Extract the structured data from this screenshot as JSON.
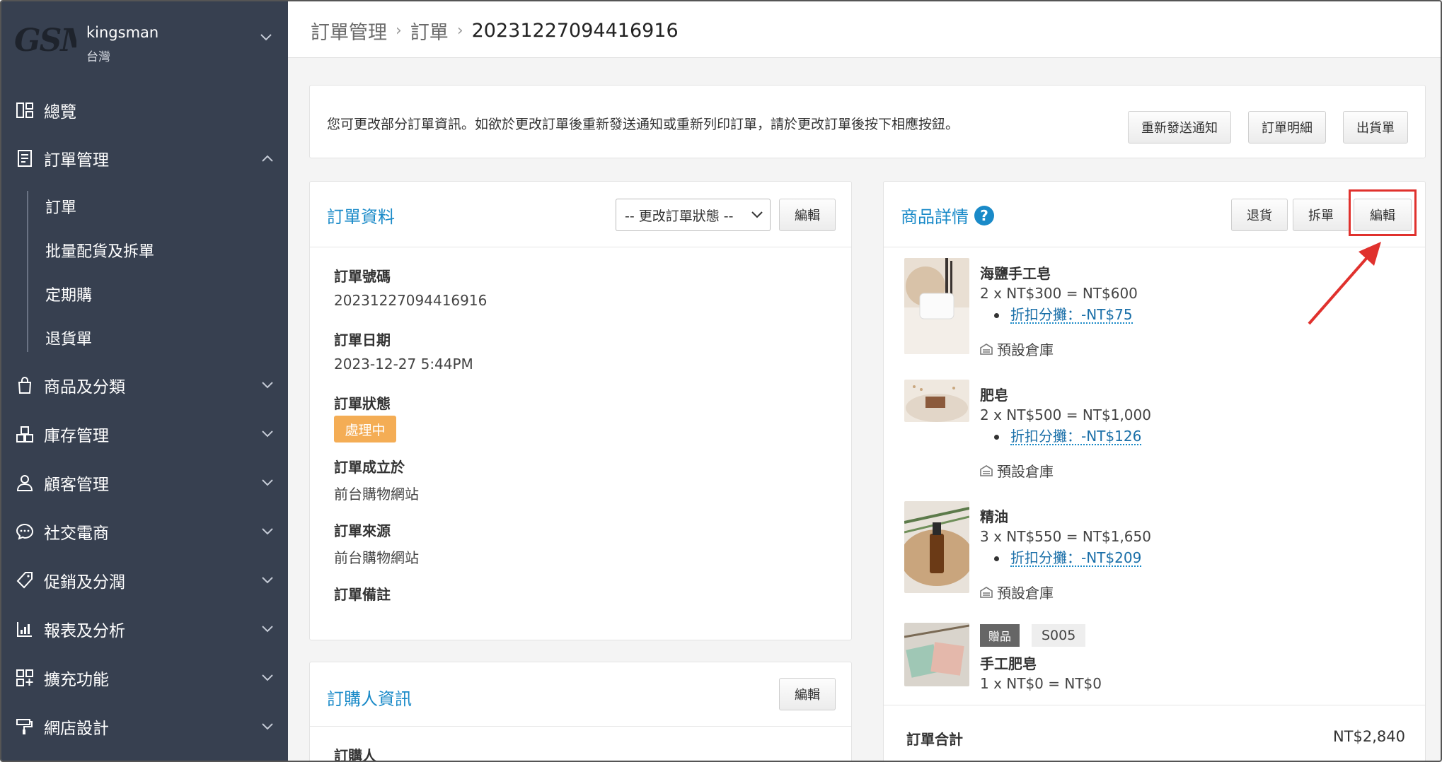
{
  "sidebar": {
    "brand": {
      "logo": "GSM",
      "name": "kingsman",
      "region": "台灣"
    },
    "items": [
      {
        "label": "總覽",
        "icon": "dashboard-icon"
      },
      {
        "label": "訂單管理",
        "icon": "order-icon",
        "expanded": true
      },
      {
        "label": "商品及分類",
        "icon": "shopping-bag-icon"
      },
      {
        "label": "庫存管理",
        "icon": "inventory-icon"
      },
      {
        "label": "顧客管理",
        "icon": "customer-icon"
      },
      {
        "label": "社交電商",
        "icon": "chat-icon"
      },
      {
        "label": "促銷及分潤",
        "icon": "tag-icon"
      },
      {
        "label": "報表及分析",
        "icon": "chart-icon"
      },
      {
        "label": "擴充功能",
        "icon": "apps-icon"
      },
      {
        "label": "網店設計",
        "icon": "paint-roller-icon"
      }
    ],
    "sub_items": [
      "訂單",
      "批量配貨及拆單",
      "定期購",
      "退貨單"
    ]
  },
  "breadcrumb": {
    "level1": "訂單管理",
    "level2": "訂單",
    "current": "20231227094416916"
  },
  "notice": {
    "text": "您可更改部分訂單資訊。如欲於更改訂單後重新發送通知或重新列印訂單，請於更改訂單後按下相應按鈕。",
    "buttons": [
      "重新發送通知",
      "訂單明細",
      "出貨單"
    ]
  },
  "order_info": {
    "title": "訂單資料",
    "status_select": "-- 更改訂單狀態 --",
    "edit_label": "編輯",
    "fields": {
      "number_label": "訂單號碼",
      "number": "20231227094416916",
      "date_label": "訂單日期",
      "date": "2023-12-27 5:44PM",
      "status_label": "訂單狀態",
      "status": "處理中",
      "created_at_label": "訂單成立於",
      "created_at": "前台購物網站",
      "source_label": "訂單來源",
      "source": "前台購物網站",
      "note_label": "訂單備註"
    }
  },
  "buyer_info": {
    "title": "訂購人資訊",
    "edit_label": "編輯",
    "buyer_label": "訂購人"
  },
  "products": {
    "title": "商品詳情",
    "buttons": {
      "return": "退貨",
      "split": "拆單",
      "edit": "編輯"
    },
    "warehouse": "預設倉庫",
    "items": [
      {
        "name": "海鹽手工皂",
        "calc": "2 x NT$300 = NT$600",
        "discount": "折扣分攤：-NT$75"
      },
      {
        "name": "肥皂",
        "calc": "2 x NT$500 = NT$1,000",
        "discount": "折扣分攤：-NT$126"
      },
      {
        "name": "精油",
        "calc": "3 x NT$550 = NT$1,650",
        "discount": "折扣分攤：-NT$209"
      },
      {
        "name": "手工肥皂",
        "calc": "1 x NT$0 = NT$0",
        "gift": "贈品",
        "sku": "S005"
      }
    ],
    "total_label": "訂單合計",
    "total": "NT$2,840"
  },
  "colors": {
    "sidebar_bg": "#374050",
    "link": "#1a8ac8",
    "status": "#f4ad55",
    "highlight": "#e0312d"
  }
}
